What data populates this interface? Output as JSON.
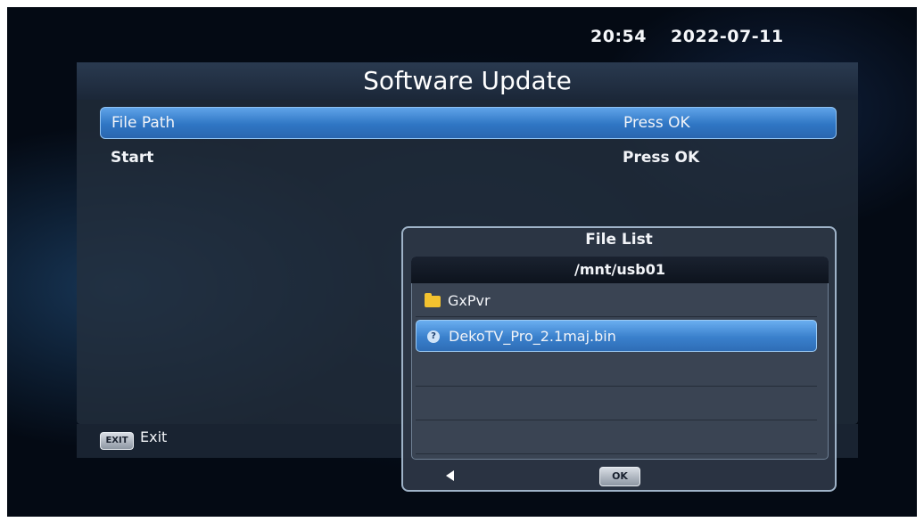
{
  "status": {
    "time": "20:54",
    "date": "2022-07-11"
  },
  "window": {
    "title": "Software Update"
  },
  "menu": [
    {
      "label": "File Path",
      "value": "Press OK",
      "selected": true
    },
    {
      "label": "Start",
      "value": "Press OK",
      "selected": false
    }
  ],
  "footer": {
    "exit_key": "EXIT",
    "exit_label": "Exit"
  },
  "file_dialog": {
    "title": "File List",
    "path": "/mnt/usb01",
    "items": [
      {
        "name": "GxPvr",
        "icon": "folder-icon",
        "selected": false
      },
      {
        "name": "DekoTV_Pro_2.1maj.bin",
        "icon": "file-icon",
        "selected": true
      }
    ],
    "file_icon_glyph": "?",
    "ok_label": "OK"
  },
  "colors": {
    "selection": "#3a80cc",
    "folder": "#f3c22f",
    "background": "#040a14"
  }
}
